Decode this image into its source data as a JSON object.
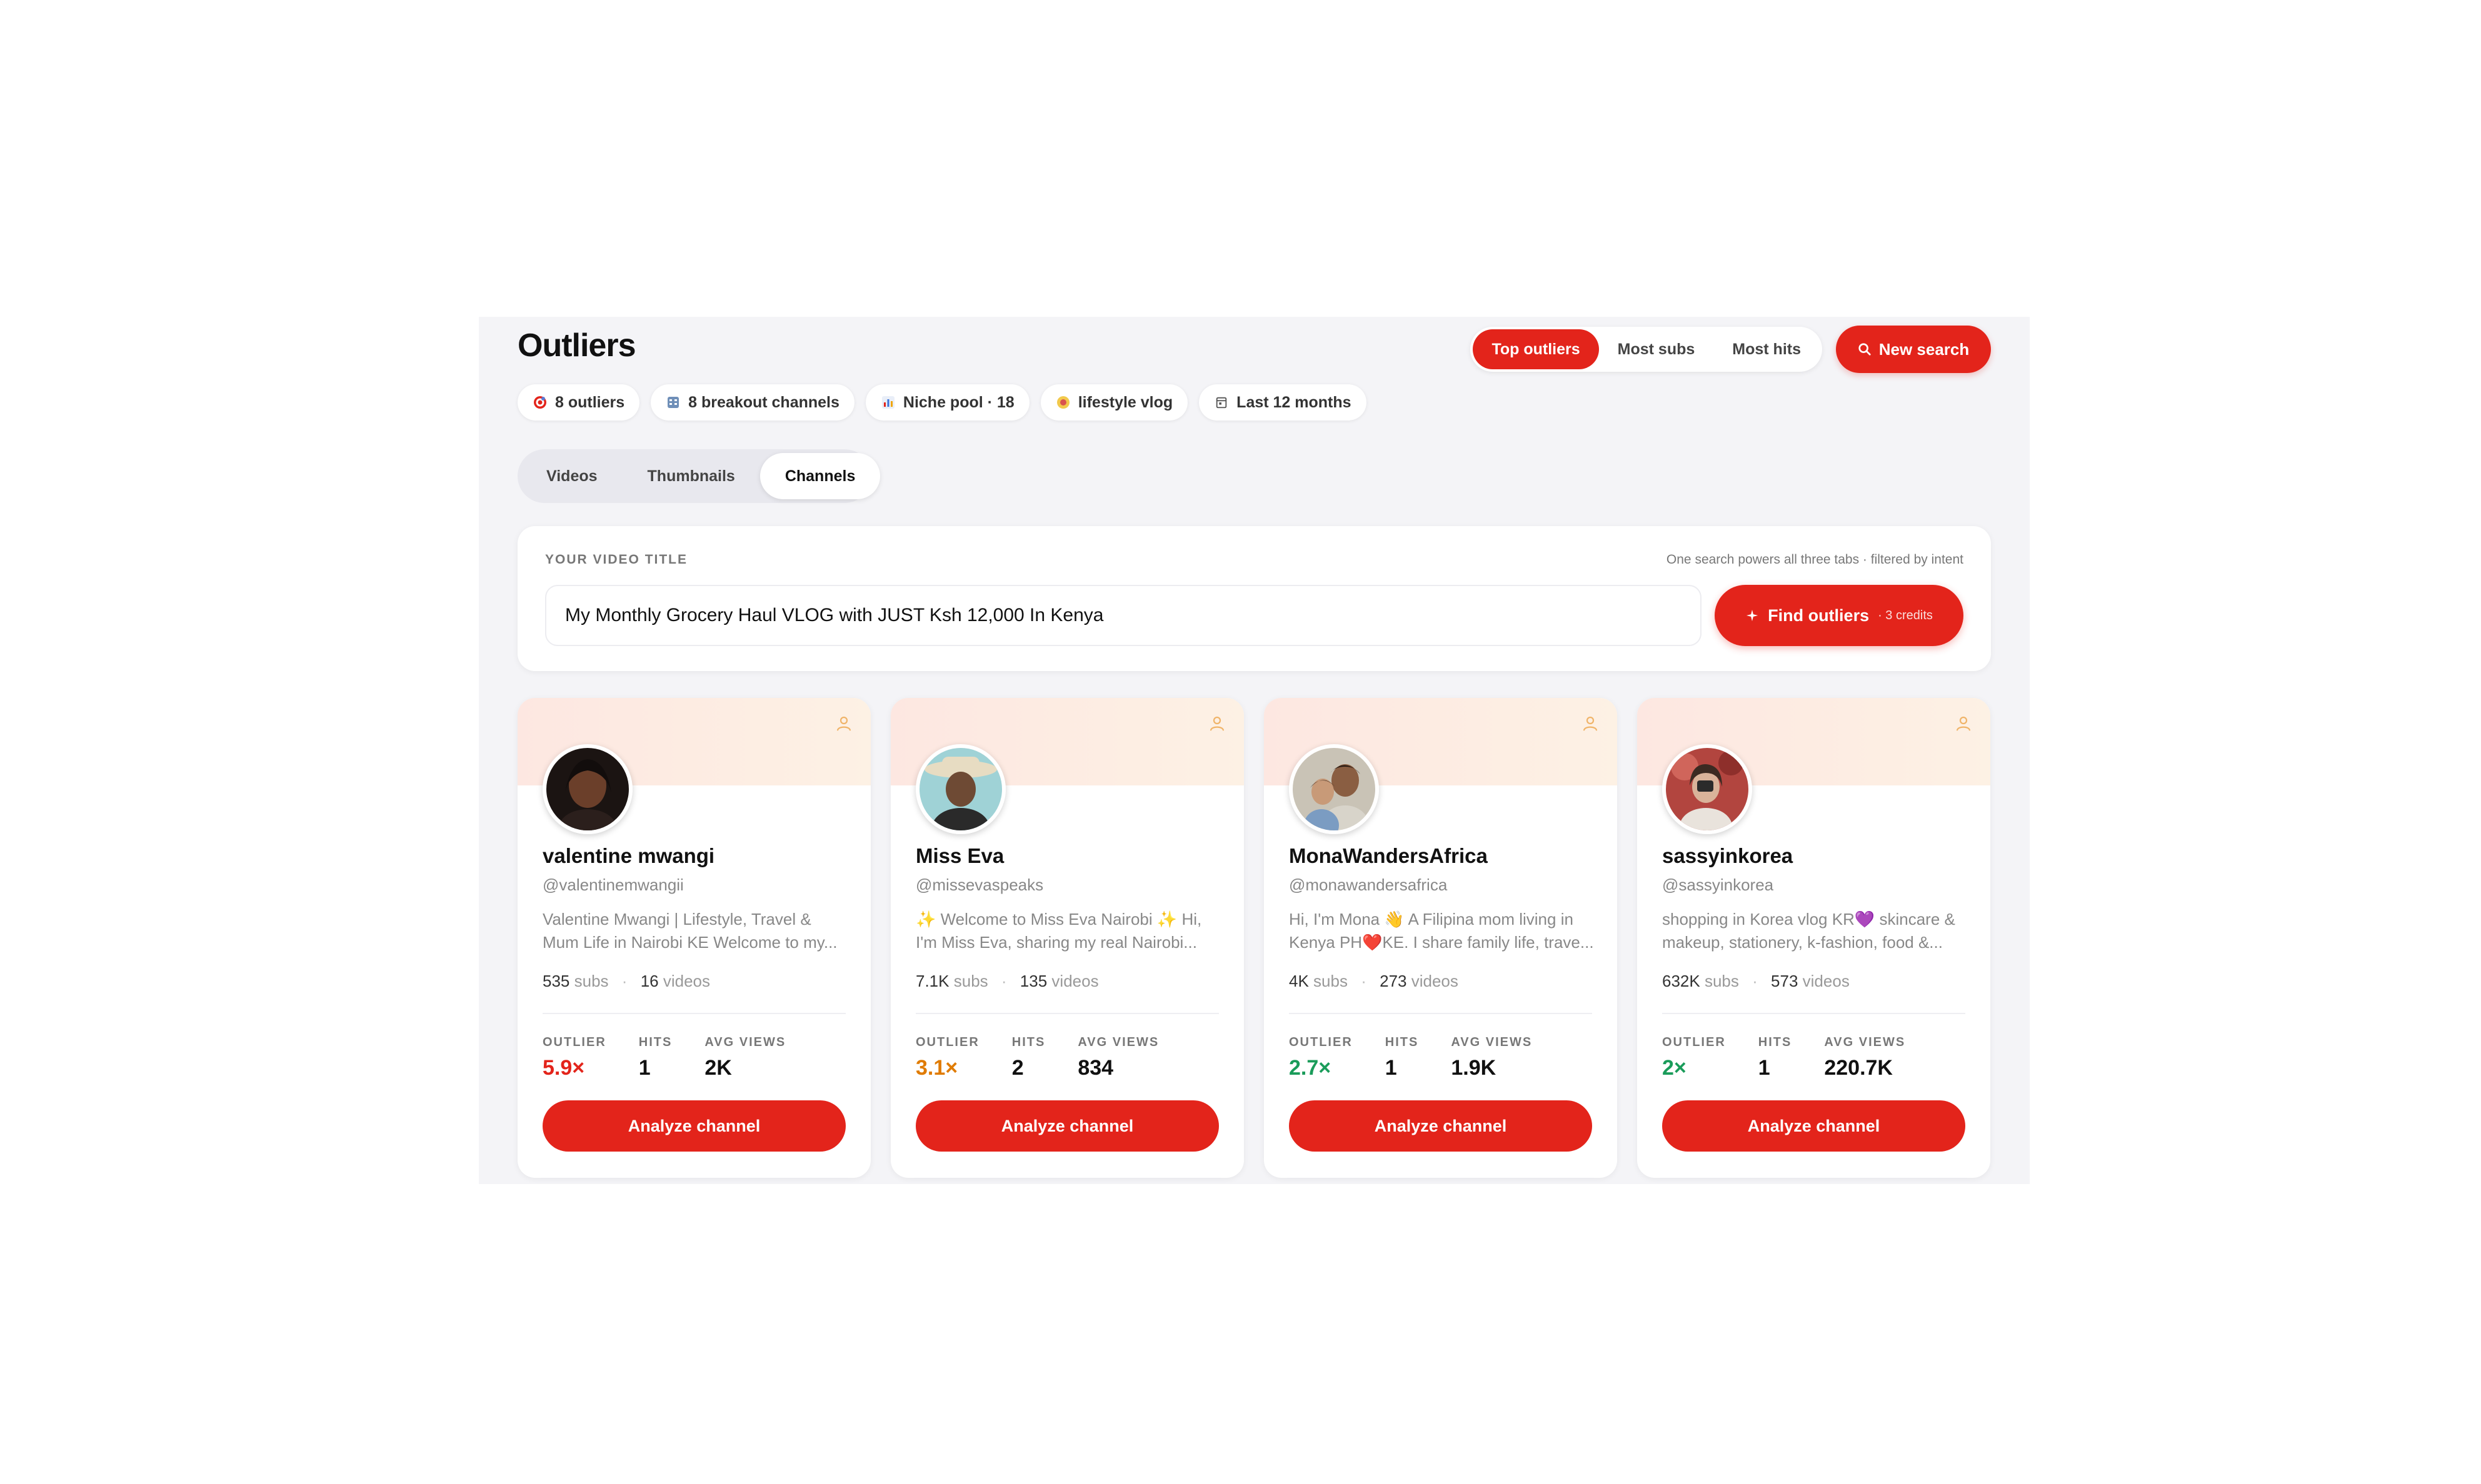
{
  "page": {
    "title": "Outliers",
    "sort_tabs": [
      {
        "label": "Top outliers",
        "active": true
      },
      {
        "label": "Most subs",
        "active": false
      },
      {
        "label": "Most hits",
        "active": false
      }
    ],
    "new_search_label": "New search"
  },
  "chips": [
    {
      "icon": "target-icon",
      "label": "8 outliers"
    },
    {
      "icon": "building-icon",
      "label": "8 breakout channels"
    },
    {
      "icon": "bar-chart-icon",
      "label": "Niche pool · 18"
    },
    {
      "icon": "niche-icon",
      "label": "lifestyle vlog"
    },
    {
      "icon": "calendar-icon",
      "label": "Last 12 months"
    }
  ],
  "view_tabs": [
    {
      "label": "Videos",
      "active": false
    },
    {
      "label": "Thumbnails",
      "active": false
    },
    {
      "label": "Channels",
      "active": true
    }
  ],
  "search": {
    "label": "YOUR VIDEO TITLE",
    "hint": "One search powers all three tabs · filtered by intent",
    "value": "My Monthly Grocery Haul VLOG with JUST Ksh 12,000 In Kenya",
    "button_label": "Find outliers",
    "credits": "· 3 credits"
  },
  "stat_labels": {
    "outlier": "OUTLIER",
    "hits": "HITS",
    "avg_views": "AVG VIEWS"
  },
  "cards": [
    {
      "name": "valentine mwangi",
      "handle": "@valentinemwangii",
      "description": "Valentine Mwangi | Lifestyle, Travel & Mum Life in Nairobi KE Welcome to my...",
      "subs": "535",
      "subs_label": "subs",
      "videos": "16",
      "videos_label": "videos",
      "outlier": "5.9×",
      "outlier_color": "#e3241b",
      "hits": "1",
      "avg_views": "2K",
      "button_label": "Analyze channel"
    },
    {
      "name": "Miss Eva",
      "handle": "@missevaspeaks",
      "description": "✨ Welcome to Miss Eva Nairobi ✨ Hi, I'm Miss Eva, sharing my real Nairobi...",
      "subs": "7.1K",
      "subs_label": "subs",
      "videos": "135",
      "videos_label": "videos",
      "outlier": "3.1×",
      "outlier_color": "#e07b00",
      "hits": "2",
      "avg_views": "834",
      "button_label": "Analyze channel"
    },
    {
      "name": "MonaWandersAfrica",
      "handle": "@monawandersafrica",
      "description": "Hi, I'm Mona 👋 A Filipina mom living in Kenya PH❤️KE. I share family life, trave...",
      "subs": "4K",
      "subs_label": "subs",
      "videos": "273",
      "videos_label": "videos",
      "outlier": "2.7×",
      "outlier_color": "#1a9c5a",
      "hits": "1",
      "avg_views": "1.9K",
      "button_label": "Analyze channel"
    },
    {
      "name": "sassyinkorea",
      "handle": "@sassyinkorea",
      "description": "shopping in Korea vlog KR💜 skincare & makeup, stationery, k-fashion, food &...",
      "subs": "632K",
      "subs_label": "subs",
      "videos": "573",
      "videos_label": "videos",
      "outlier": "2×",
      "outlier_color": "#1a9c5a",
      "hits": "1",
      "avg_views": "220.7K",
      "button_label": "Analyze channel"
    }
  ],
  "colors": {
    "accent": "#e3241b",
    "panel_bg": "#f4f4f7"
  }
}
